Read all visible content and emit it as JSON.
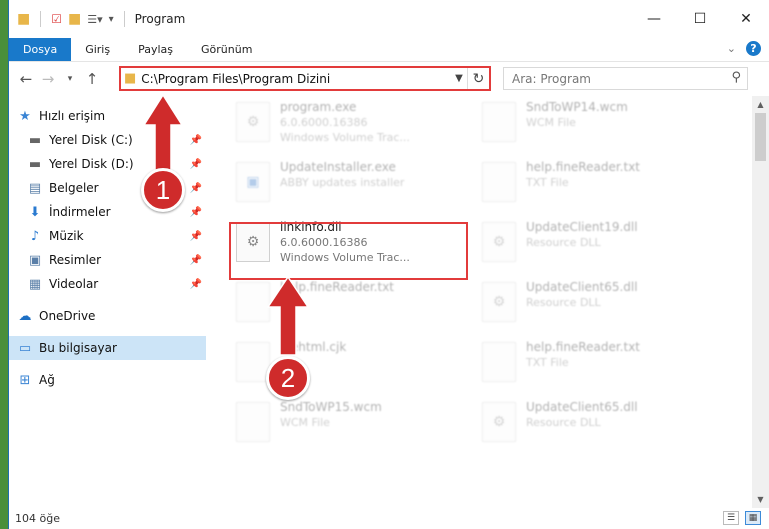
{
  "window": {
    "title": "Program",
    "controls": {
      "minimize": "—",
      "maximize": "☐",
      "close": "✕"
    }
  },
  "ribbon": {
    "tabs": [
      {
        "label": "Dosya",
        "active": true
      },
      {
        "label": "Giriş"
      },
      {
        "label": "Paylaş"
      },
      {
        "label": "Görünüm"
      }
    ]
  },
  "address": {
    "path": "C:\\Program Files\\Program Dizini",
    "search_placeholder": "Ara: Program"
  },
  "nav": {
    "quick_access": "Hızlı erişim",
    "items": [
      {
        "label": "Yerel Disk (C:)",
        "icon": "drive-icon"
      },
      {
        "label": "Yerel Disk (D:)",
        "icon": "drive-icon"
      },
      {
        "label": "Belgeler",
        "icon": "documents-icon"
      },
      {
        "label": "İndirmeler",
        "icon": "downloads-icon"
      },
      {
        "label": "Müzik",
        "icon": "music-icon"
      },
      {
        "label": "Resimler",
        "icon": "pictures-icon"
      },
      {
        "label": "Videolar",
        "icon": "videos-icon"
      }
    ],
    "onedrive": "OneDrive",
    "this_pc": "Bu bilgisayar",
    "network": "Ağ"
  },
  "files": {
    "col1": [
      {
        "name": "program.exe",
        "line2": "6.0.6000.16386",
        "line3": "Windows Volume Trac..."
      },
      {
        "name": "UpdateInstaller.exe",
        "line2": "ABBY updates installer",
        "line3": ""
      },
      {
        "name": "linkinfo.dll",
        "line2": "6.0.6000.16386",
        "line3": "Windows Volume Trac..."
      },
      {
        "name": "help.fineReader.txt",
        "line2": "File",
        "line3": ""
      },
      {
        "name": "filehtml.cjk",
        "line2": "File",
        "line3": ""
      },
      {
        "name": "SndToWP15.wcm",
        "line2": "WCM File",
        "line3": ""
      }
    ],
    "col2": [
      {
        "name": "SndToWP14.wcm",
        "line2": "WCM File"
      },
      {
        "name": "help.fineReader.txt",
        "line2": "TXT File"
      },
      {
        "name": "UpdateClient19.dll",
        "line2": "Resource DLL"
      },
      {
        "name": "UpdateClient65.dll",
        "line2": "Resource DLL"
      },
      {
        "name": "help.fineReader.txt",
        "line2": "TXT File"
      },
      {
        "name": "UpdateClient65.dll",
        "line2": "Resource DLL"
      }
    ]
  },
  "status": {
    "count": "104 öğe"
  },
  "annotations": {
    "step1": "1",
    "step2": "2",
    "color": "#cf2b2b"
  }
}
